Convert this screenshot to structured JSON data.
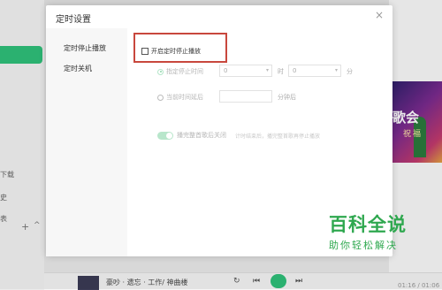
{
  "background": {
    "sidebar_items": [
      "下载",
      "史",
      "表"
    ],
    "banner_title": "歌会",
    "banner_sub": "祝福",
    "player": {
      "title": "豪吵 · 遗忘 · 工作/ 神曲楼",
      "time": "01:16 / 01:06"
    }
  },
  "dialog": {
    "title": "定时设置",
    "close_glyph": "×",
    "nav": [
      {
        "label": "定时停止播放"
      },
      {
        "label": "定时关机"
      }
    ],
    "enable_label": "开启定时停止播放",
    "option_specified": {
      "label": "指定停止时间",
      "hour_value": "0",
      "hour_unit": "时",
      "minute_value": "0",
      "minute_unit": "分"
    },
    "option_delay": {
      "label": "当前时间延后",
      "unit": "分钟后",
      "value": ""
    },
    "toggle": {
      "label": "播完整首歌后关闭",
      "hint": "计时结束后，播完整首歌再停止播放",
      "on": true
    }
  },
  "watermark": {
    "main": "百科全说",
    "sub": "助你轻松解决"
  },
  "colors": {
    "accent": "#2fc07a",
    "highlight": "#c8473d",
    "watermark": "#2fa84f"
  }
}
